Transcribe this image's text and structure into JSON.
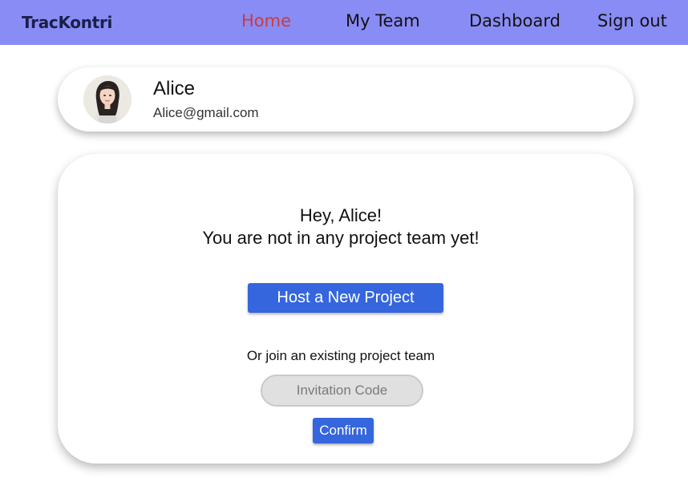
{
  "nav": {
    "brand": "TracKontri",
    "links": [
      {
        "label": "Home",
        "active": true
      },
      {
        "label": "My Team"
      },
      {
        "label": "Dashboard"
      },
      {
        "label": "Sign out"
      }
    ],
    "bar_color": "#8a8cf5",
    "active_color": "#cc3b3b"
  },
  "profile": {
    "name": "Alice",
    "email": "Alice@gmail.com",
    "avatar_icon": "user-photo"
  },
  "main": {
    "greeting_line1": "Hey, Alice!",
    "greeting_line2": "You are not in any project team yet!",
    "host_button": "Host a New Project",
    "join_text": "Or join an existing project team",
    "invitation_placeholder": "Invitation Code",
    "invitation_value": "",
    "confirm_button": "Confirm",
    "button_color": "#3566dd"
  }
}
